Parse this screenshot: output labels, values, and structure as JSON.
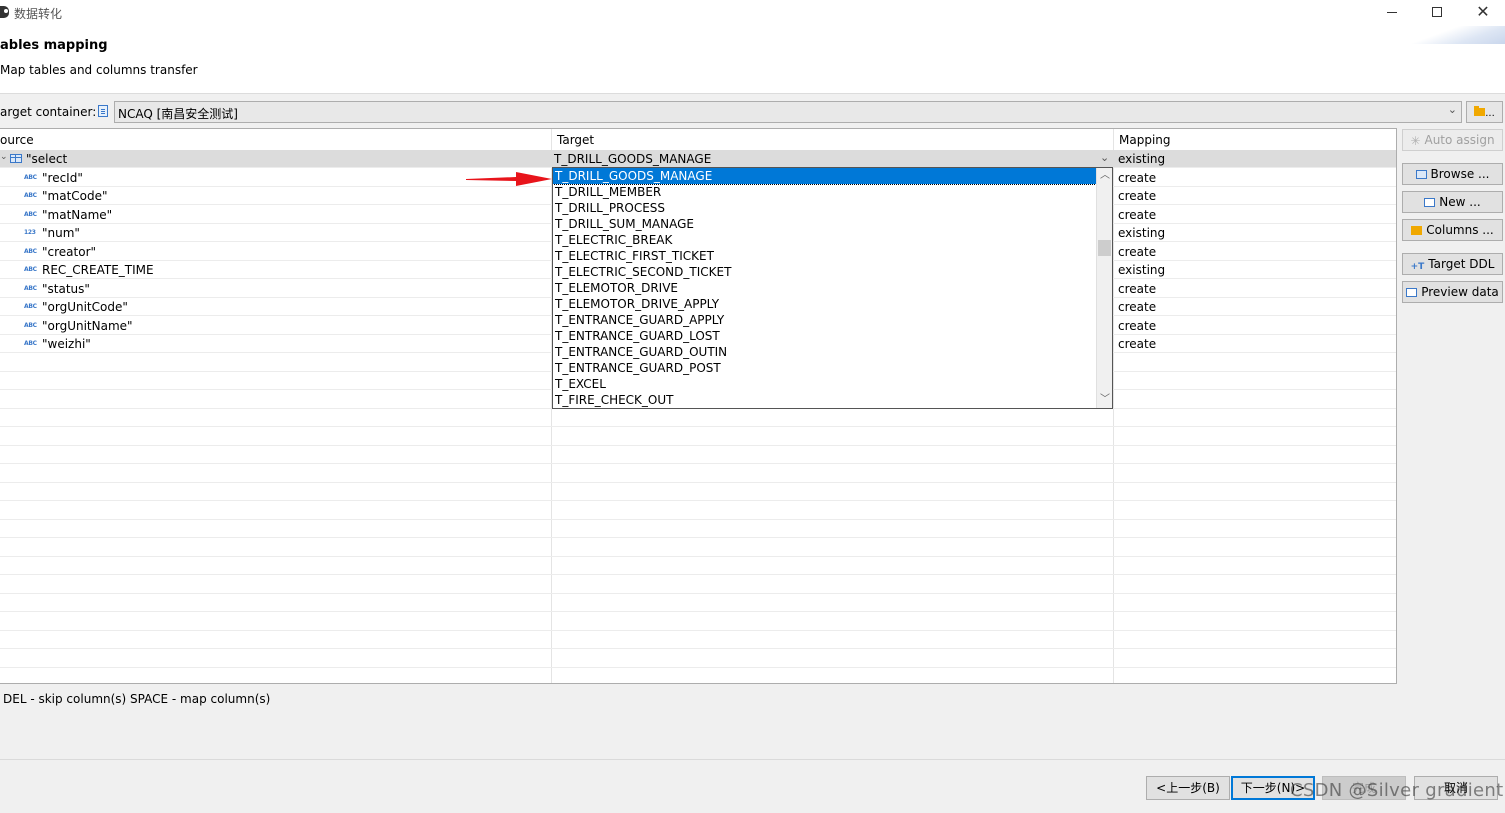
{
  "window": {
    "title": "数据转化",
    "min_icon": "minimize-icon",
    "max_icon": "maximize-icon",
    "close_glyph": "✕"
  },
  "page": {
    "title": "ables mapping",
    "subtitle": "Map tables and columns transfer"
  },
  "target_container": {
    "label": "arget container:",
    "value": "NCAQ  [南昌安全测试]",
    "browse_label": "..."
  },
  "table": {
    "headers": {
      "source": "ource",
      "target": "Target",
      "mapping": "Mapping"
    },
    "rows": [
      {
        "source": "\"select",
        "type": "table",
        "target": "T_DRILL_GOODS_MANAGE",
        "mapping": "existing"
      },
      {
        "source": "\"recId\"",
        "type": "ABC",
        "target": "",
        "mapping": "create"
      },
      {
        "source": "\"matCode\"",
        "type": "ABC",
        "target": "",
        "mapping": "create"
      },
      {
        "source": "\"matName\"",
        "type": "ABC",
        "target": "",
        "mapping": "create"
      },
      {
        "source": "\"num\"",
        "type": "123",
        "target": "",
        "mapping": "existing"
      },
      {
        "source": "\"creator\"",
        "type": "ABC",
        "target": "",
        "mapping": "create"
      },
      {
        "source": "REC_CREATE_TIME",
        "type": "ABC",
        "target": "",
        "mapping": "existing"
      },
      {
        "source": "\"status\"",
        "type": "ABC",
        "target": "",
        "mapping": "create"
      },
      {
        "source": "\"orgUnitCode\"",
        "type": "ABC",
        "target": "",
        "mapping": "create"
      },
      {
        "source": "\"orgUnitName\"",
        "type": "ABC",
        "target": "",
        "mapping": "create"
      },
      {
        "source": "\"weizhi\"",
        "type": "ABC",
        "target": "",
        "mapping": "create"
      }
    ]
  },
  "dropdown": {
    "items": [
      "T_DRILL_GOODS_MANAGE",
      "T_DRILL_MEMBER",
      "T_DRILL_PROCESS",
      "T_DRILL_SUM_MANAGE",
      "T_ELECTRIC_BREAK",
      "T_ELECTRIC_FIRST_TICKET",
      "T_ELECTRIC_SECOND_TICKET",
      "T_ELEMOTOR_DRIVE",
      "T_ELEMOTOR_DRIVE_APPLY",
      "T_ENTRANCE_GUARD_APPLY",
      "T_ENTRANCE_GUARD_LOST",
      "T_ENTRANCE_GUARD_OUTIN",
      "T_ENTRANCE_GUARD_POST",
      "T_EXCEL",
      "T_FIRE_CHECK_OUT"
    ],
    "highlighted_index": 0
  },
  "side_buttons": {
    "auto_assign": "Auto assign",
    "browse": "Browse ...",
    "new": "New ...",
    "columns": "Columns ...",
    "target_ddl": "Target DDL",
    "preview_data": "Preview data"
  },
  "hint": "DEL - skip column(s)  SPACE - map column(s)",
  "footer": {
    "back": "<上一步(B)",
    "next": "下一步(N)>",
    "finish": "完成",
    "cancel": "取消"
  },
  "watermark": "CSDN @Silver gradient",
  "colors": {
    "selection": "#0078d7",
    "annotation_arrow": "#e8141b",
    "row_selected": "#dcdcdc"
  }
}
